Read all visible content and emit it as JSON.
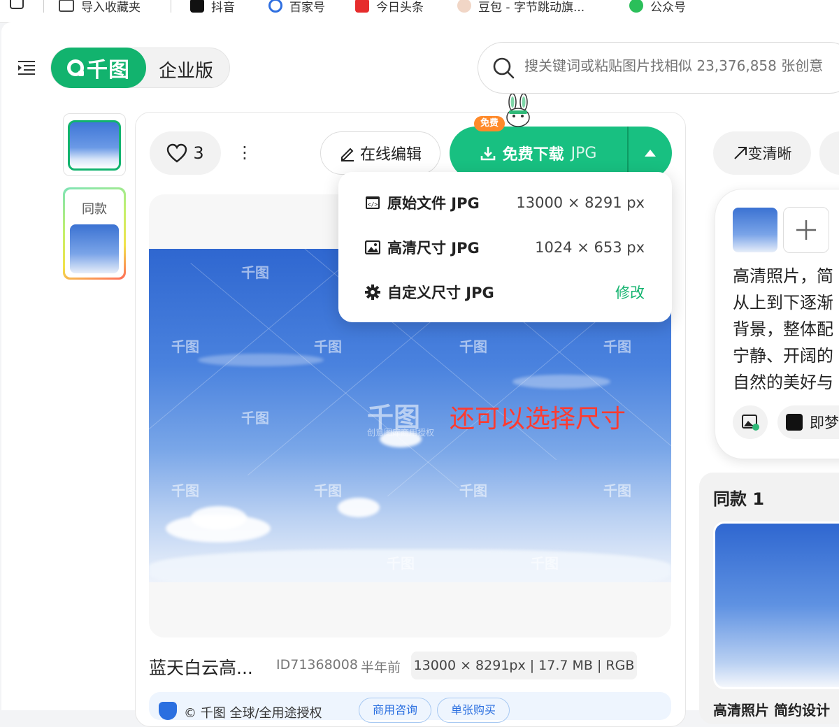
{
  "bookmarks": [
    {
      "label": "导入收藏夹"
    },
    {
      "label": "抖音"
    },
    {
      "label": "百家号"
    },
    {
      "label": "今日头条"
    },
    {
      "label": "豆包 - 字节跳动旗..."
    },
    {
      "label": "公众号"
    }
  ],
  "brand": {
    "logo_text": "千图",
    "enterprise_label": "企业版",
    "accent": "#12b36e"
  },
  "search": {
    "placeholder": "搜关键词或粘贴图片找相似 23,376,858 张创意"
  },
  "thumbs": {
    "second_label": "同款"
  },
  "toolbar": {
    "like_count": "3",
    "more_label": "⋮",
    "edit_label": "在线编辑",
    "download_label": "免费下载",
    "download_format": "JPG",
    "free_badge": "免费"
  },
  "dropdown": {
    "items": [
      {
        "name": "原始文件 JPG",
        "value": "13000 × 8291 px"
      },
      {
        "name": "高清尺寸 JPG",
        "value": "1024 × 653 px"
      },
      {
        "name": "自定义尺寸 JPG",
        "link": "修改"
      }
    ]
  },
  "image": {
    "watermark": "千图",
    "watermark_sub": "创意图库商用授权",
    "annotation": "还可以选择尺寸"
  },
  "info": {
    "title": "蓝天白云高...",
    "id": "ID71368008",
    "time": "半年前",
    "specs": "13000 × 8291px | 17.7 MB | RGB"
  },
  "footer": {
    "text": "© 千图 全球/全用途授权",
    "pill1": "商用咨询",
    "pill2": "单张购买"
  },
  "right": {
    "clarify_label": "变清晰",
    "ai_lines": [
      "高清照片，简",
      "从上到下逐渐",
      "背景，整体配",
      "宁静、开阔的",
      "自然的美好与"
    ],
    "ai_tool_label": "即梦",
    "similar_title": "同款 1",
    "similar_caption": "高清照片 简约设计"
  }
}
